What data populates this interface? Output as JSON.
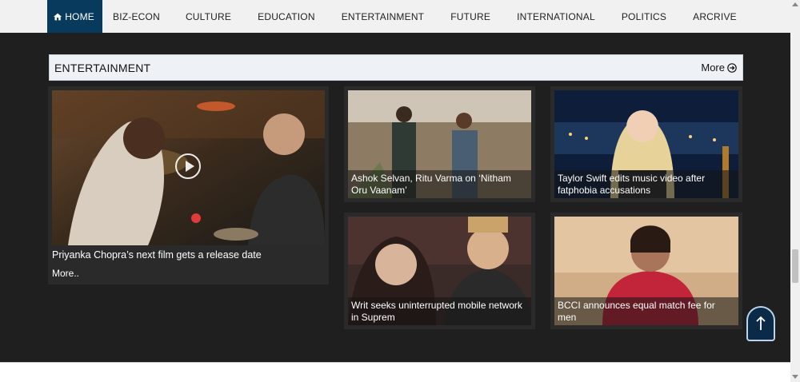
{
  "nav": {
    "items": [
      {
        "label": "HOME",
        "active": true,
        "icon": "home-icon"
      },
      {
        "label": "BIZ-ECON"
      },
      {
        "label": "CULTURE"
      },
      {
        "label": "EDUCATION"
      },
      {
        "label": "ENTERTAINMENT"
      },
      {
        "label": "FUTURE"
      },
      {
        "label": "INTERNATIONAL"
      },
      {
        "label": "POLITICS"
      },
      {
        "label": "ARCRIVE"
      }
    ]
  },
  "section": {
    "title": "ENTERTAINMENT",
    "more_label": "More"
  },
  "featured": {
    "caption": "Priyanka Chopra’s next film gets a release date",
    "more_label": "More.."
  },
  "cards": [
    {
      "caption": "Ashok Selvan, Ritu Varma on ‘Nitham Oru Vaanam’"
    },
    {
      "caption": "Taylor Swift edits music video after fatphobia accusations"
    },
    {
      "caption": "Writ seeks uninterrupted mobile network in Suprem"
    },
    {
      "caption": "BCCI announces equal match fee for men"
    }
  ],
  "colors": {
    "nav_active": "#073a5c",
    "section_bg": "#1f1f1f",
    "header_bg": "#eef2f7"
  }
}
